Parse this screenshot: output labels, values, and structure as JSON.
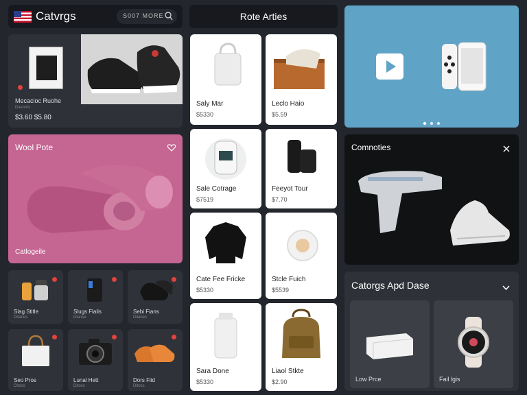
{
  "header": {
    "title": "Catvrgs",
    "more_label": "S007 MORE",
    "center_title": "Rote Arties"
  },
  "featured": {
    "title": "Mecacioc Ruohe",
    "subtitle": "Dasmirs",
    "price": "$3.60 $5.80"
  },
  "promo": {
    "title": "Wool Pote",
    "caption": "Catlogeile"
  },
  "small_items": [
    {
      "label": "Slag Stitle",
      "sub": "Ditanes"
    },
    {
      "label": "Slugs Flalis",
      "sub": "Dlanse"
    },
    {
      "label": "Sebi Fians",
      "sub": "Dilanes"
    },
    {
      "label": "Seo Pros",
      "sub": "Ditoss"
    },
    {
      "label": "Lunal Hett",
      "sub": "Ditoss"
    },
    {
      "label": "Dors Fiid",
      "sub": "Ditoss"
    }
  ],
  "products": [
    {
      "name": "Saly Mar",
      "price": "$5330"
    },
    {
      "name": "Leclo Haio",
      "price": "$5.59"
    },
    {
      "name": "Sale Cotrage",
      "price": "$7519"
    },
    {
      "name": "Feeyot Tour",
      "price": "$7.70"
    },
    {
      "name": "Cate Fee Fricke",
      "price": "$5330"
    },
    {
      "name": "Stcle Fuich",
      "price": "$5539"
    },
    {
      "name": "Sara Done",
      "price": "$5330"
    },
    {
      "name": "Liaol Stkte",
      "price": "$2.90"
    }
  ],
  "commodities": {
    "title": "Comnoties"
  },
  "categories": {
    "title": "Catorgs Apd Dase",
    "items": [
      {
        "label": "Low Prce"
      },
      {
        "label": "Fail lgis"
      }
    ]
  },
  "colors": {
    "background": "#23262d",
    "video_panel": "#5fa3c6",
    "promo_panel": "#c46592",
    "accent_red": "#e0443c"
  },
  "icons": {
    "flag": "us-flag-icon",
    "search": "search-icon",
    "play": "play-icon",
    "heart": "heart-icon",
    "close": "close-icon",
    "chevron": "chevron-down-icon"
  }
}
